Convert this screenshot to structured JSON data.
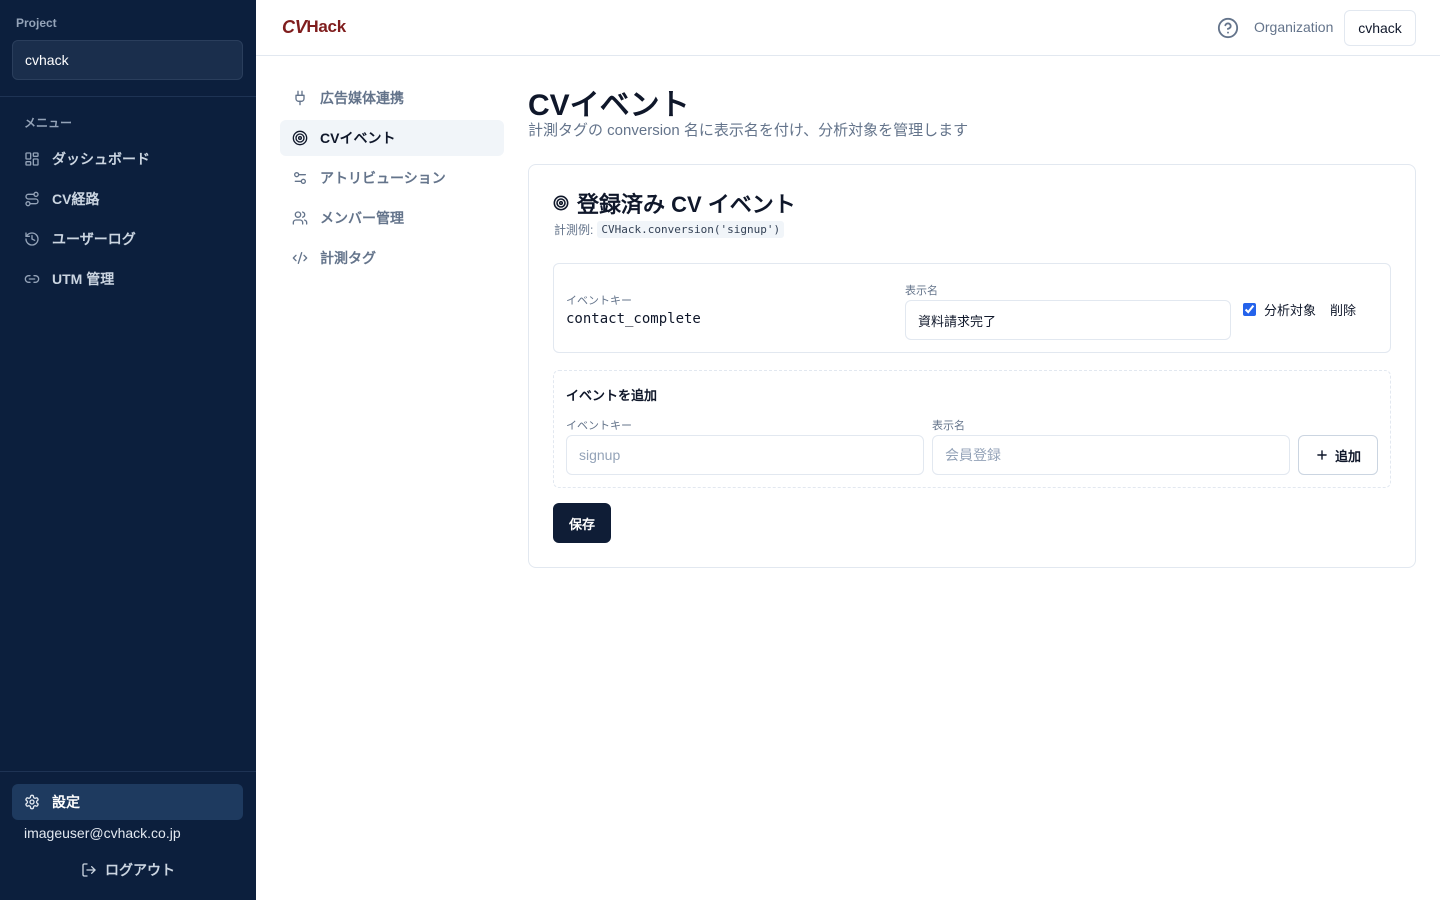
{
  "sidebar": {
    "project_label": "Project",
    "project_value": "cvhack",
    "menu_label": "メニュー",
    "items": [
      {
        "label": "ダッシュボード",
        "icon": "dashboard-icon"
      },
      {
        "label": "CV経路",
        "icon": "route-icon"
      },
      {
        "label": "ユーザーログ",
        "icon": "history-icon"
      },
      {
        "label": "UTM 管理",
        "icon": "link-icon"
      }
    ],
    "settings_label": "設定",
    "user_email": "imageuser@cvhack.co.jp",
    "logout_label": "ログアウト"
  },
  "header": {
    "logo_cv": "CV",
    "logo_hack": "Hack",
    "org_label": "Organization",
    "org_value": "cvhack"
  },
  "settings_nav": {
    "items": [
      {
        "label": "広告媒体連携",
        "icon": "plug-icon",
        "active": false
      },
      {
        "label": "CVイベント",
        "icon": "target-icon",
        "active": true
      },
      {
        "label": "アトリビューション",
        "icon": "sliders-icon",
        "active": false
      },
      {
        "label": "メンバー管理",
        "icon": "users-icon",
        "active": false
      },
      {
        "label": "計測タグ",
        "icon": "code-icon",
        "active": false
      }
    ]
  },
  "main": {
    "title": "CVイベント",
    "subtitle": "計測タグの conversion 名に表示名を付け、分析対象を管理します",
    "card": {
      "title": "登録済み CV イベント",
      "example_label": "計測例:",
      "example_code": "CVHack.conversion('signup')",
      "events": [
        {
          "key_label": "イベントキー",
          "key": "contact_complete",
          "name_label": "表示名",
          "name": "資料請求完了",
          "analysis_label": "分析対象",
          "analysis_checked": true,
          "delete_label": "削除"
        }
      ],
      "add": {
        "title": "イベントを追加",
        "key_label": "イベントキー",
        "key_placeholder": "signup",
        "name_label": "表示名",
        "name_placeholder": "会員登録",
        "button_label": "追加"
      },
      "save_label": "保存"
    }
  }
}
